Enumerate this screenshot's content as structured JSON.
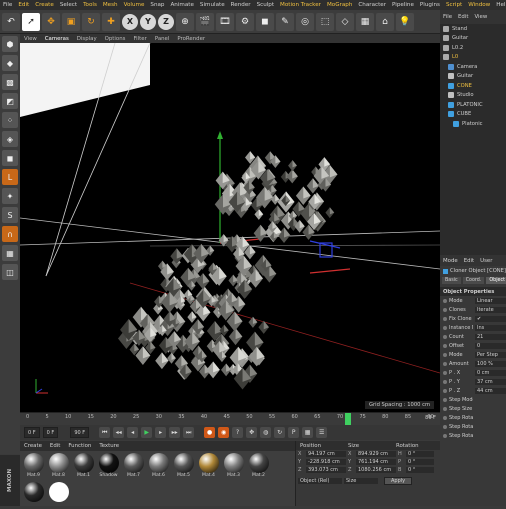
{
  "menubar": [
    "File",
    "Edit",
    "Create",
    "Select",
    "Tools",
    "Mesh",
    "Volume",
    "Snap",
    "Animate",
    "Simulate",
    "Render",
    "Sculpt",
    "Motion Tracker",
    "MoGraph",
    "Character",
    "Pipeline",
    "Plugins",
    "Script",
    "Window",
    "Help"
  ],
  "toolbar": {
    "axes": [
      "X",
      "Y",
      "Z"
    ]
  },
  "viewport": {
    "menu": [
      "View",
      "Cameras",
      "Display",
      "Options",
      "Filter",
      "Panel",
      "ProRender"
    ],
    "grid_spacing": "Grid Spacing : 1000 cm"
  },
  "timeline": {
    "ticks": [
      "0",
      "5",
      "10",
      "15",
      "20",
      "25",
      "30",
      "35",
      "40",
      "45",
      "50",
      "55",
      "60",
      "65",
      "70",
      "75",
      "80",
      "85",
      "90"
    ],
    "current_frame_value": 71,
    "end_label": "89 F",
    "start_field": "0 F",
    "min_field": "0 F",
    "max_field": "90 F"
  },
  "materials": {
    "menu": [
      "Create",
      "Edit",
      "Function",
      "Texture"
    ],
    "items": [
      {
        "name": "Mat.9",
        "color": "#6a6a6a"
      },
      {
        "name": "Mat.8",
        "color": "#909090"
      },
      {
        "name": "Mat.1",
        "color": "#3a3a3a"
      },
      {
        "name": "Shadow",
        "color": "#111111"
      },
      {
        "name": "Mat.7",
        "color": "#5a5a5a"
      },
      {
        "name": "Mat.6",
        "color": "#7a7a7a"
      },
      {
        "name": "Mat.5",
        "color": "#555555"
      },
      {
        "name": "Mat.4",
        "color": "#b08838"
      },
      {
        "name": "Mat.3",
        "color": "#808080"
      },
      {
        "name": "Mat.2",
        "color": "#444444"
      },
      {
        "name": "",
        "color": "#2a2a2a"
      },
      {
        "name": "",
        "color": "#ffffff"
      }
    ],
    "brand": "MAXON"
  },
  "coords": {
    "headers": [
      "Position",
      "Size",
      "Rotation"
    ],
    "rows": [
      {
        "pl": "X",
        "pos": "94.197 cm",
        "sl": "X",
        "size": "894.929 cm",
        "rl": "H",
        "rot": "0 °"
      },
      {
        "pl": "Y",
        "pos": "-228.918 cm",
        "sl": "Y",
        "size": "761.194 cm",
        "rl": "P",
        "rot": "0 °"
      },
      {
        "pl": "Z",
        "pos": "393.073 cm",
        "sl": "Z",
        "size": "1080.256 cm",
        "rl": "B",
        "rot": "0 °"
      }
    ],
    "mode_select": "Object (Rel)",
    "size_select": "Size",
    "apply": "Apply"
  },
  "objects": {
    "menu": [
      "File",
      "Edit",
      "View"
    ],
    "items": [
      {
        "label": "Stand",
        "color": "#aaaaaa",
        "indent": 0,
        "sel": false
      },
      {
        "label": "Guitar",
        "color": "#aaaaaa",
        "indent": 0,
        "sel": false
      },
      {
        "label": "L0.2",
        "color": "#aaaaaa",
        "indent": 0,
        "sel": false
      },
      {
        "label": "L0",
        "color": "#aaaaaa",
        "indent": 0,
        "sel": true
      },
      {
        "label": "Camera",
        "color": "#5090d0",
        "indent": 1,
        "sel": false
      },
      {
        "label": "Guitar",
        "color": "#c0c0c0",
        "indent": 1,
        "sel": false
      },
      {
        "label": "CONE",
        "color": "#40a0e0",
        "indent": 1,
        "sel": true
      },
      {
        "label": "Studio",
        "color": "#c0c0c0",
        "indent": 1,
        "sel": false
      },
      {
        "label": "PLATONIC",
        "color": "#40a0e0",
        "indent": 1,
        "sel": false
      },
      {
        "label": "CUBE",
        "color": "#40a0e0",
        "indent": 1,
        "sel": false
      },
      {
        "label": "Platonic",
        "color": "#40a0e0",
        "indent": 2,
        "sel": false
      }
    ]
  },
  "attributes": {
    "menu": [
      "Mode",
      "Edit",
      "User"
    ],
    "object_title": "Cloner Object [CONE]",
    "tabs": [
      "Basic",
      "Coord.",
      "Object"
    ],
    "section": "Object Properties",
    "rows": [
      {
        "label": "Mode",
        "value": "Linear"
      },
      {
        "label": "Clones",
        "value": "Iterate"
      },
      {
        "label": "Fix Clone",
        "value": "✔"
      },
      {
        "label": "Instance Mode",
        "value": "Ins"
      },
      {
        "label": "Count",
        "value": "21"
      },
      {
        "label": "Offset",
        "value": "0"
      },
      {
        "label": "Mode",
        "value": "Per Step"
      },
      {
        "label": "Amount",
        "value": "100 %"
      },
      {
        "label": "P . X",
        "value": "0 cm"
      },
      {
        "label": "P . Y",
        "value": "37 cm"
      },
      {
        "label": "P . Z",
        "value": "44 cm"
      },
      {
        "label": "Step Mode",
        "value": ""
      },
      {
        "label": "Step Size",
        "value": ""
      },
      {
        "label": "Step Rotation . H",
        "value": ""
      },
      {
        "label": "Step Rotation . P",
        "value": ""
      },
      {
        "label": "Step Rotation . B",
        "value": ""
      }
    ]
  }
}
